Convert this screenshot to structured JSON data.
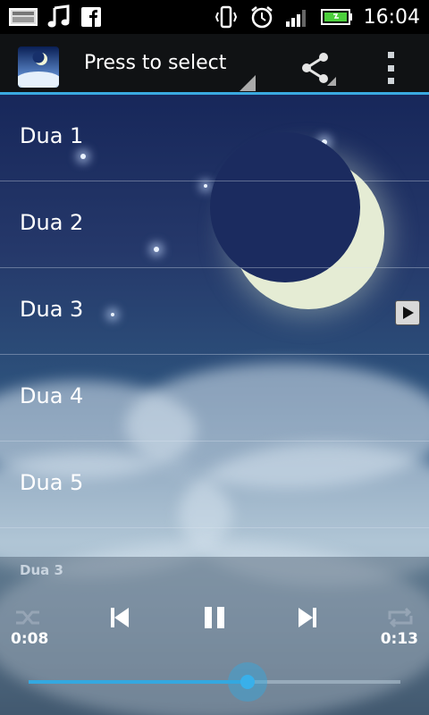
{
  "status_bar": {
    "time": "16:04",
    "left_icons": [
      "screenshot-icon",
      "music-note-icon",
      "facebook-icon"
    ],
    "right_icons": [
      "vibrate-icon",
      "alarm-icon",
      "signal-icon",
      "battery-icon"
    ]
  },
  "action_bar": {
    "selector_label": "Press to select",
    "share_icon": "share-icon",
    "overflow_icon": "overflow-menu-icon"
  },
  "playlist": {
    "items": [
      {
        "label": "Dua 1",
        "playing": false
      },
      {
        "label": "Dua 2",
        "playing": false
      },
      {
        "label": "Dua 3",
        "playing": true
      },
      {
        "label": "Dua 4",
        "playing": false
      },
      {
        "label": "Dua 5",
        "playing": false
      }
    ]
  },
  "player": {
    "now_playing": "Dua 3",
    "elapsed": "0:08",
    "duration": "0:13",
    "progress": 0.59,
    "controls": [
      "shuffle-icon",
      "previous-icon",
      "pause-icon",
      "next-icon",
      "repeat-icon"
    ]
  },
  "colors": {
    "accent": "#34a8e0",
    "action_bar_bg": "#101214",
    "status_bar_bg": "#000000"
  }
}
